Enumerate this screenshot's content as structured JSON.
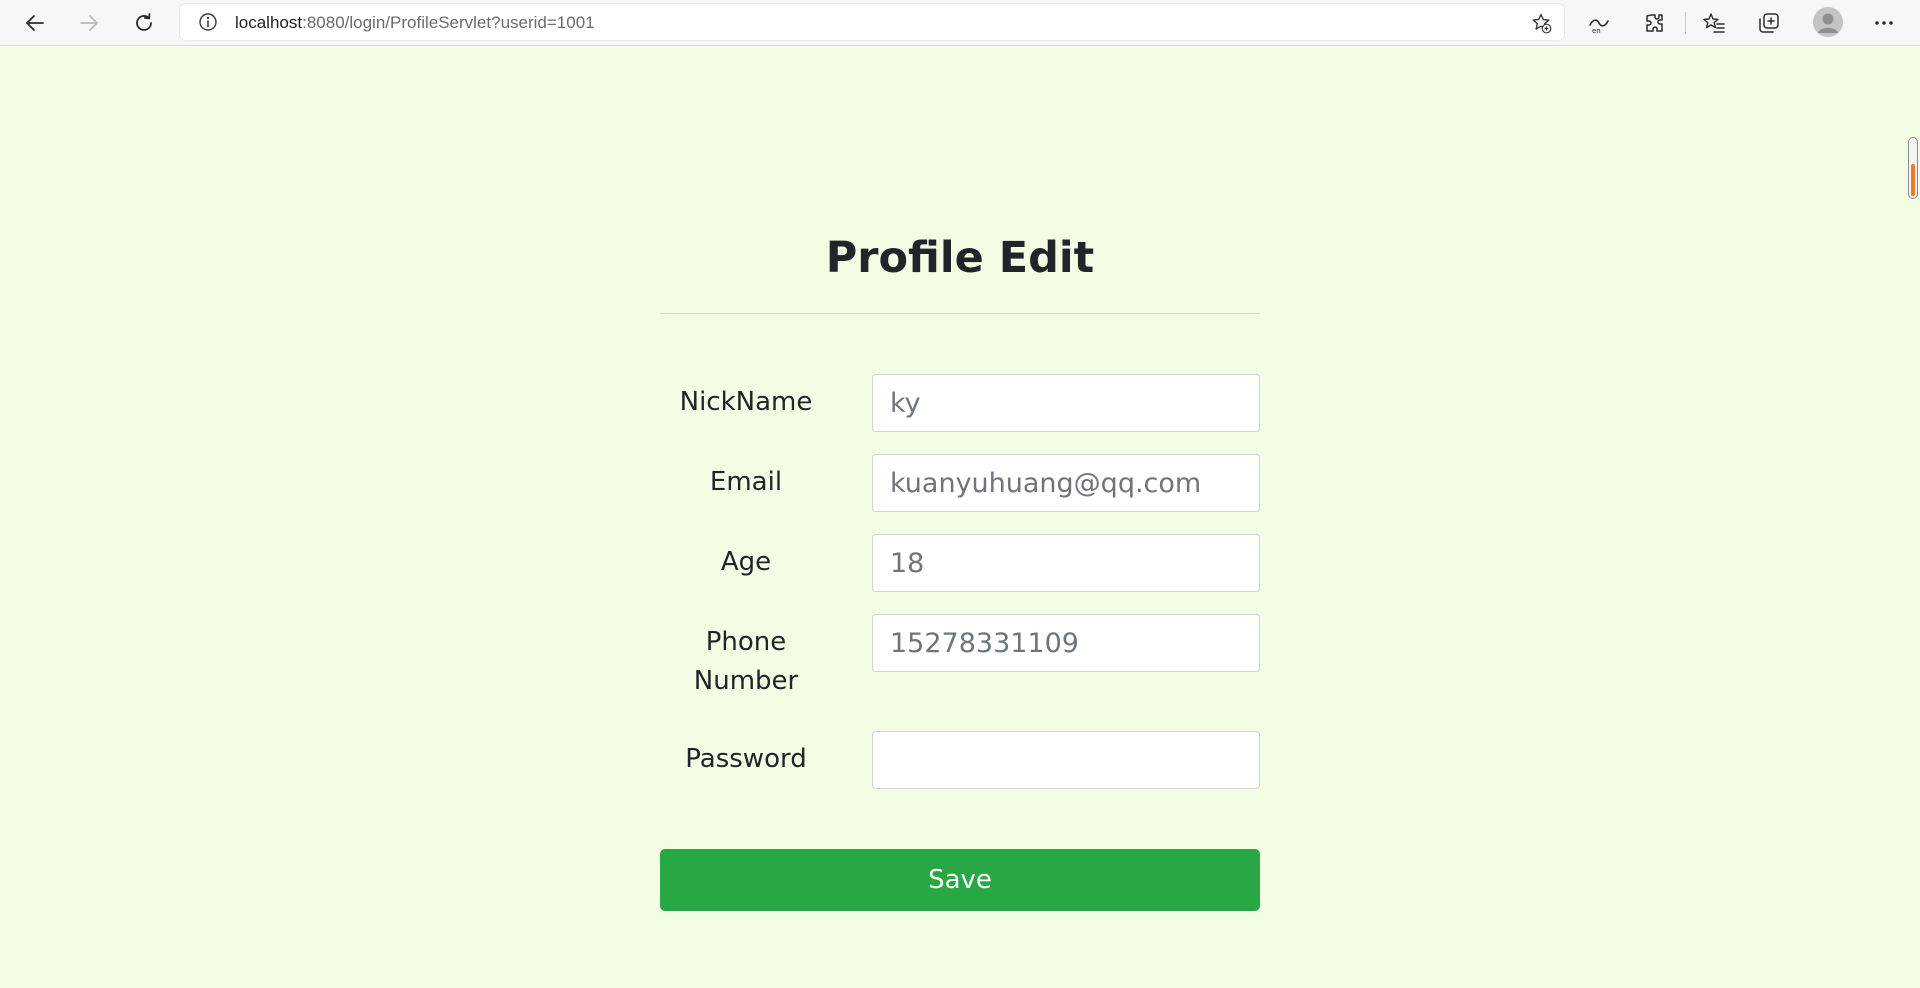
{
  "browser": {
    "url_host": "localhost",
    "url_rest": ":8080/login/ProfileServlet?userid=1001",
    "icons": [
      "back-arrow-icon",
      "forward-arrow-icon",
      "refresh-icon",
      "info-icon",
      "add-favorite-icon",
      "read-aloud-icon",
      "extensions-icon",
      "favorites-icon",
      "collections-icon",
      "profile-icon",
      "more-icon"
    ]
  },
  "form": {
    "title": "Profile Edit",
    "fields": [
      {
        "label": "NickName",
        "value": "ky"
      },
      {
        "label": "Email",
        "value": "kuanyuhuang@qq.com"
      },
      {
        "label": "Age",
        "value": "18"
      },
      {
        "label_line1": "Phone",
        "label_line2": "Number",
        "value": "15278331109"
      },
      {
        "label": "Password",
        "value": ""
      }
    ],
    "save_label": "Save"
  },
  "colors": {
    "page_background": "#f2fde4",
    "save_button": "#28a745",
    "scroll_indicator": "#f07a2a"
  }
}
